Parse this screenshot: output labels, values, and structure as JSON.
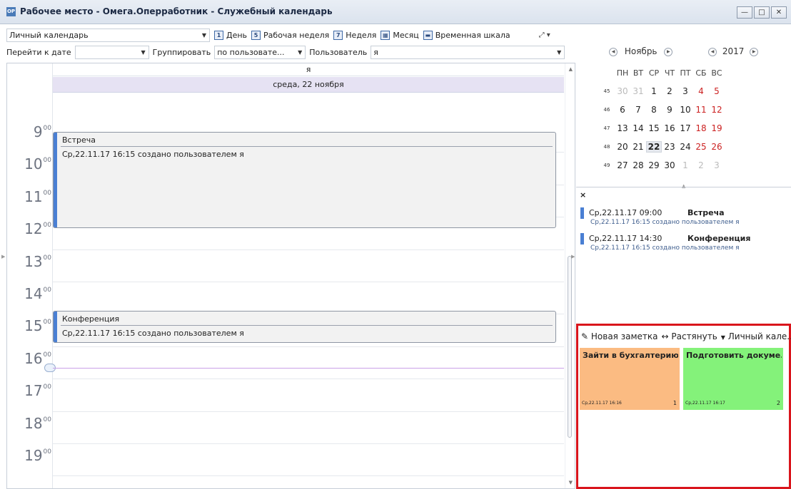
{
  "window": {
    "app_icon": "OP",
    "title": "Рабочее место - Омега.Оперработник - Служебный календарь",
    "buttons": [
      "—",
      "□",
      "✕"
    ]
  },
  "toolbar": {
    "calendar": "Личный календарь",
    "views": [
      {
        "icon": "1",
        "label": "День"
      },
      {
        "icon": "5",
        "label": "Рабочая неделя"
      },
      {
        "icon": "7",
        "label": "Неделя"
      },
      {
        "icon": "▦",
        "label": "Месяц"
      },
      {
        "icon": "▬",
        "label": "Временная шкала"
      }
    ],
    "extra": "⤢ ▾"
  },
  "filter": {
    "goto_label": "Перейти к дате",
    "goto_value": "",
    "group_label": "Группировать",
    "group_value": "по пользовате...",
    "user_label": "Пользователь",
    "user_value": "я"
  },
  "dayview": {
    "owner": "я",
    "date": "среда, 22 ноября",
    "hours": [
      {
        "h": "9",
        "m": "00"
      },
      {
        "h": "10",
        "m": "00"
      },
      {
        "h": "11",
        "m": "00"
      },
      {
        "h": "12",
        "m": "00"
      },
      {
        "h": "13",
        "m": "00"
      },
      {
        "h": "14",
        "m": "00"
      },
      {
        "h": "15",
        "m": "00"
      },
      {
        "h": "16",
        "m": "00"
      },
      {
        "h": "17",
        "m": "00"
      },
      {
        "h": "18",
        "m": "00"
      },
      {
        "h": "19",
        "m": "00"
      }
    ],
    "appointments": [
      {
        "subject": "Встреча",
        "info": "Ср,22.11.17 16:15 создано пользователем я"
      },
      {
        "subject": "Конференция",
        "info": "Ср,22.11.17 16:15 создано пользователем я"
      }
    ]
  },
  "mini_calendar": {
    "month": "Ноябрь",
    "year": "2017",
    "weekdays": [
      "ПН",
      "ВТ",
      "СР",
      "ЧТ",
      "ПТ",
      "СБ",
      "ВС"
    ],
    "weeks": [
      {
        "num": "45",
        "days": [
          "30",
          "31",
          "1",
          "2",
          "3",
          "4",
          "5"
        ]
      },
      {
        "num": "46",
        "days": [
          "6",
          "7",
          "8",
          "9",
          "10",
          "11",
          "12"
        ]
      },
      {
        "num": "47",
        "days": [
          "13",
          "14",
          "15",
          "16",
          "17",
          "18",
          "19"
        ]
      },
      {
        "num": "48",
        "days": [
          "20",
          "21",
          "22",
          "23",
          "24",
          "25",
          "26"
        ]
      },
      {
        "num": "49",
        "days": [
          "27",
          "28",
          "29",
          "30",
          "1",
          "2",
          "3"
        ]
      }
    ],
    "today": "22",
    "weekend_color": "#cc2222"
  },
  "agenda": {
    "close": "×",
    "items": [
      {
        "time": "Ср,22.11.17 09:00",
        "subject": "Встреча",
        "info": "Ср,22.11.17 16:15 создано пользователем я"
      },
      {
        "time": "Ср,22.11.17 14:30",
        "subject": "Конференция",
        "info": "Ср,22.11.17 16:15 создано пользователем я"
      }
    ]
  },
  "notes": {
    "new_note": "Новая заметка",
    "stretch": "Растянуть",
    "calendar": "Личный кале...",
    "items": [
      {
        "title": "Зайти в бухгалтерию",
        "date": "Ср,22.11.17 16:16",
        "num": "1",
        "color": "#fbbb82"
      },
      {
        "title": "Подготовить докуме...",
        "date": "Ср,22.11.17 16:17",
        "num": "2",
        "color": "#84f27a"
      }
    ]
  },
  "colors": {
    "accent": "#4a7fd3",
    "date_header": "#e6e2f3",
    "highlight_border": "#d9151c"
  }
}
